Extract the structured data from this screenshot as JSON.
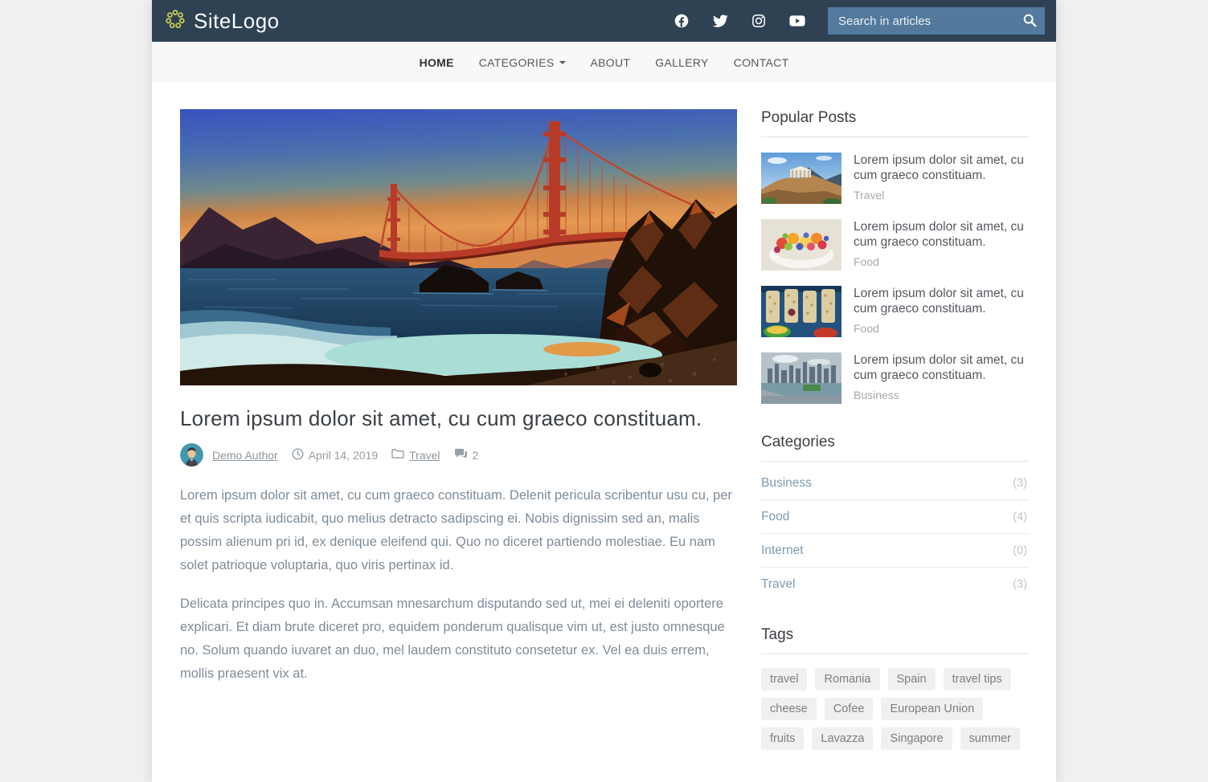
{
  "brand": {
    "name": "SiteLogo"
  },
  "topbar": {
    "social_icons": [
      "facebook",
      "twitter",
      "instagram",
      "youtube"
    ],
    "search": {
      "placeholder": "Search in articles"
    }
  },
  "nav": {
    "items": [
      {
        "label": "HOME",
        "active": true
      },
      {
        "label": "CATEGORIES",
        "dropdown": true
      },
      {
        "label": "ABOUT"
      },
      {
        "label": "GALLERY"
      },
      {
        "label": "CONTACT"
      }
    ]
  },
  "article": {
    "hero_image": "golden-gate-bridge-at-sunset-from-baker-beach",
    "title": "Lorem ipsum dolor sit amet, cu cum graeco constituam.",
    "meta": {
      "author": "Demo Author",
      "date": "April 14, 2019",
      "category": "Travel",
      "comments": "2"
    },
    "paragraphs": [
      "Lorem ipsum dolor sit amet, cu cum graeco constituam. Delenit pericula scribentur usu cu, per et quis scripta iudicabit, quo melius detracto sadipscing ei. Nobis dignissim sed an, malis possim alienum pri id, ex denique eleifend qui. Quo no diceret partiendo molestiae. Eu nam solet patrioque voluptaria, quo viris pertinax id.",
      "Delicata principes quo in. Accumsan mnesarchum disputando sed ut, mei ei deleniti oportere explicari. Et diam brute diceret pro, equidem ponderum qualisque vim ut, est justo omnesque no. Solum quando iuvaret an duo, mel laudem constituto consetetur ex. Vel ea duis errem, mollis praesent vix at."
    ]
  },
  "sidebar": {
    "popular": {
      "title": "Popular Posts",
      "posts": [
        {
          "title": "Lorem ipsum dolor sit amet, cu cum graeco constituam.",
          "category": "Travel",
          "thumb": "acropolis-athens"
        },
        {
          "title": "Lorem ipsum dolor sit amet, cu cum graeco constituam.",
          "category": "Food",
          "thumb": "fruit-salad-bowl"
        },
        {
          "title": "Lorem ipsum dolor sit amet, cu cum graeco constituam.",
          "category": "Food",
          "thumb": "street-food-trays"
        },
        {
          "title": "Lorem ipsum dolor sit amet, cu cum graeco constituam.",
          "category": "Business",
          "thumb": "singapore-skyline"
        }
      ]
    },
    "categories": {
      "title": "Categories",
      "items": [
        {
          "label": "Business",
          "count": "(3)"
        },
        {
          "label": "Food",
          "count": "(4)"
        },
        {
          "label": "Internet",
          "count": "(0)"
        },
        {
          "label": "Travel",
          "count": "(3)"
        }
      ]
    },
    "tags": {
      "title": "Tags",
      "items": [
        "travel",
        "Romania",
        "Spain",
        "travel tips",
        "cheese",
        "Cofee",
        "European Union",
        "fruits",
        "Lavazza",
        "Singapore",
        "summer"
      ]
    }
  },
  "colors": {
    "navbar_bg": "#2e4254",
    "search_bg": "#537a9d",
    "logo_dots": "#d2d44e",
    "category_link": "#7e9ab2",
    "body_text": "#7e8c98"
  }
}
